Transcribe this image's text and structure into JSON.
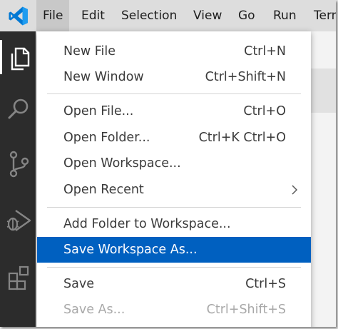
{
  "menubar": {
    "items": [
      "File",
      "Edit",
      "Selection",
      "View",
      "Go",
      "Run",
      "Terminal"
    ]
  },
  "activitybar": {
    "icons": [
      "explorer-icon",
      "search-icon",
      "source-control-icon",
      "run-debug-icon",
      "extensions-icon"
    ]
  },
  "file_menu": {
    "items": [
      {
        "label": "New File",
        "shortcut": "Ctrl+N"
      },
      {
        "label": "New Window",
        "shortcut": "Ctrl+Shift+N"
      },
      {
        "label": "Open File...",
        "shortcut": "Ctrl+O"
      },
      {
        "label": "Open Folder...",
        "shortcut": "Ctrl+K Ctrl+O"
      },
      {
        "label": "Open Workspace...",
        "shortcut": ""
      },
      {
        "label": "Open Recent",
        "shortcut": ""
      },
      {
        "label": "Add Folder to Workspace...",
        "shortcut": ""
      },
      {
        "label": "Save Workspace As...",
        "shortcut": ""
      },
      {
        "label": "Save",
        "shortcut": "Ctrl+S"
      },
      {
        "label": "Save As...",
        "shortcut": "Ctrl+Shift+S"
      }
    ],
    "selected_item": "Save Workspace As...",
    "disabled_item": "Save As..."
  },
  "colors": {
    "highlight": "#0060c0",
    "activitybar": "#2c2c2c",
    "menubar": "#dddddd",
    "logo": "#0078d4"
  }
}
